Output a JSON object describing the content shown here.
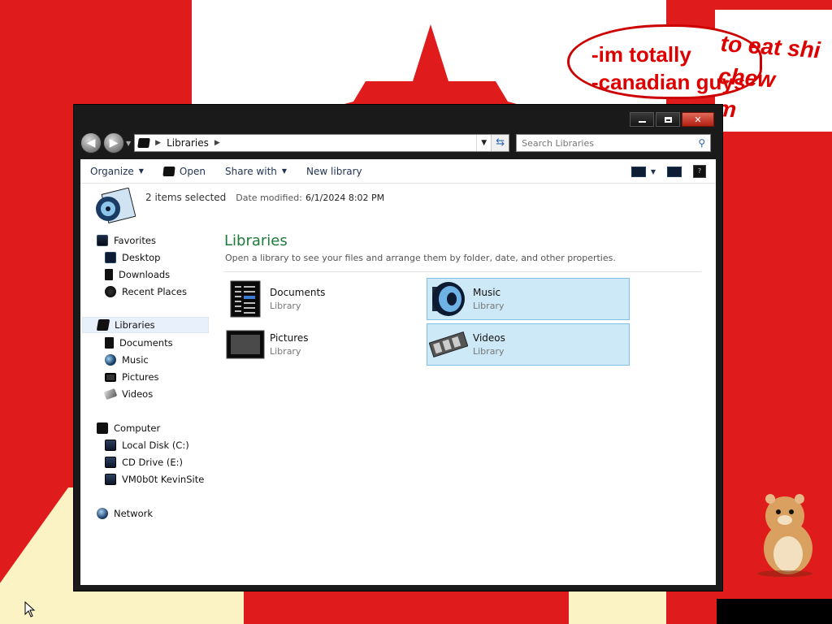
{
  "window": {
    "caption": {
      "minimize": "minimize",
      "maximize": "maximize",
      "close": "close"
    }
  },
  "address_bar": {
    "crumbs": [
      "Libraries"
    ]
  },
  "search": {
    "placeholder": "Search Libraries"
  },
  "toolbar": {
    "organize": "Organize",
    "open": "Open",
    "share_with": "Share with",
    "new_library": "New library"
  },
  "details": {
    "selection": "2 items selected",
    "date_modified_label": "Date modified:",
    "date_modified_value": "6/1/2024 8:02 PM"
  },
  "nav_tree": {
    "favorites": "Favorites",
    "desktop": "Desktop",
    "downloads": "Downloads",
    "recent_places": "Recent Places",
    "libraries": "Libraries",
    "documents": "Documents",
    "music": "Music",
    "pictures": "Pictures",
    "videos": "Videos",
    "computer": "Computer",
    "local_disk": "Local Disk (C:)",
    "cd_drive": "CD Drive (E:)",
    "network_drive": "VM0b0t KevinSite",
    "network": "Network"
  },
  "content": {
    "title": "Libraries",
    "subtitle": "Open a library to see your files and arrange them by folder, date, and other properties.",
    "libraries": [
      {
        "name": "Documents",
        "kind": "Library",
        "selected": false
      },
      {
        "name": "Music",
        "kind": "Library",
        "selected": true
      },
      {
        "name": "Pictures",
        "kind": "Library",
        "selected": false
      },
      {
        "name": "Videos",
        "kind": "Library",
        "selected": true
      }
    ]
  },
  "wallpaper": {
    "bubble_text_1": "-im totally",
    "bubble_text_2": "-canadian guys",
    "bubble_text_3": "to eat shi",
    "bubble_text_4": "chew",
    "bubble_text_5": "m"
  },
  "colors": {
    "wallpaper_red": "#e01b1b",
    "window_frame": "#1a1a1a",
    "library_title_green": "#1e7a3c",
    "selection_fill": "#cde8f7",
    "selection_border": "#7dc1e8"
  }
}
